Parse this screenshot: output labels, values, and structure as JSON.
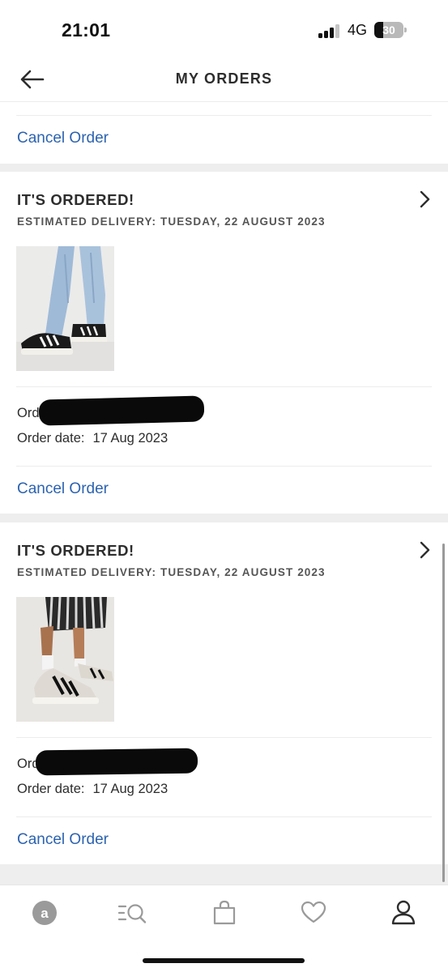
{
  "status_bar": {
    "time": "21:01",
    "network": "4G",
    "battery": "30",
    "battery_level": 0.3
  },
  "header": {
    "title": "MY ORDERS",
    "back_icon": "arrow-left-icon"
  },
  "orders": [
    {
      "cancel_label": "Cancel Order"
    },
    {
      "status": "IT'S ORDERED!",
      "delivery": "ESTIMATED DELIVERY: TUESDAY, 22 AUGUST 2023",
      "product_image": "black-white-sneakers-light-jeans",
      "order_number_label": "Order No.",
      "order_date_label": "Order date:",
      "order_date": "17 Aug 2023",
      "cancel_label": "Cancel Order"
    },
    {
      "status": "IT'S ORDERED!",
      "delivery": "ESTIMATED DELIVERY: TUESDAY, 22 AUGUST 2023",
      "product_image": "white-grey-sneakers-striped-skirt",
      "order_number_label": "Order No.",
      "order_date_label": "Order date:",
      "order_date": "17 Aug 2023",
      "cancel_label": "Cancel Order"
    }
  ],
  "tab_bar": {
    "items": [
      {
        "icon": "asos-logo-icon",
        "active": false
      },
      {
        "icon": "search-category-icon",
        "active": false
      },
      {
        "icon": "bag-icon",
        "active": false
      },
      {
        "icon": "heart-icon",
        "active": false
      },
      {
        "icon": "profile-icon",
        "active": true
      }
    ]
  },
  "colors": {
    "link": "#2c63b0",
    "text": "#2d2d2d",
    "section_gap": "#eeeeee",
    "inactive_icon": "#9a9a9a",
    "active_icon": "#2d2d2d"
  }
}
